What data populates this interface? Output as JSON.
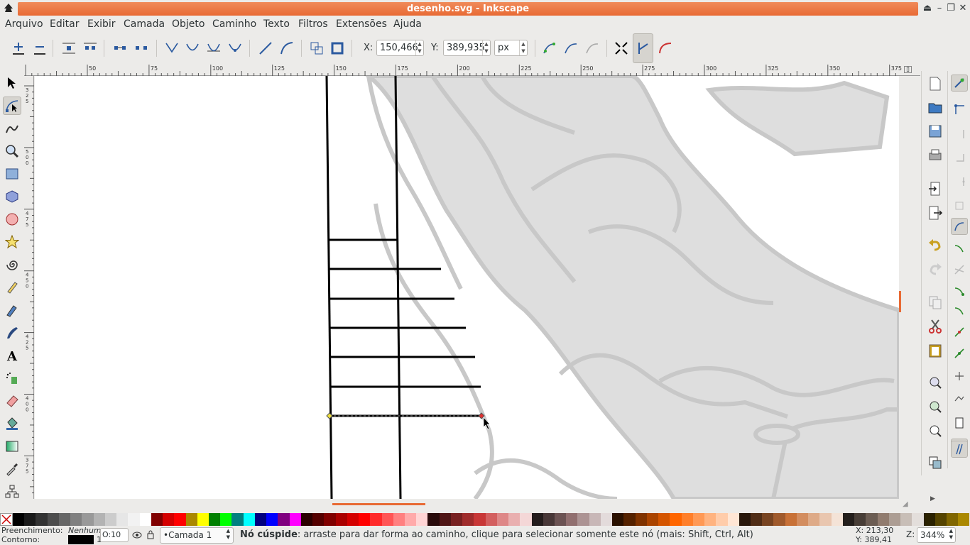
{
  "window": {
    "title": "desenho.svg - Inkscape"
  },
  "menu": [
    "Arquivo",
    "Editar",
    "Exibir",
    "Camada",
    "Objeto",
    "Caminho",
    "Texto",
    "Filtros",
    "Extensões",
    "Ajuda"
  ],
  "node_controls": {
    "x_label": "X:",
    "x_value": "150,466",
    "y_label": "Y:",
    "y_value": "389,935",
    "unit": "px"
  },
  "rulers": {
    "horizontal_ticks": [
      "50",
      "75",
      "100",
      "125",
      "150",
      "175",
      "200",
      "225",
      "250",
      "275",
      "300",
      "325",
      "350",
      "375"
    ],
    "vertical_labels": [
      "3\n2\n5",
      "5\n0\n0",
      "4\n7\n5",
      "4\n5\n0",
      "4\n2\n5",
      "4\n0\n0",
      "3\n7\n5"
    ]
  },
  "palette": {
    "colors": [
      "#000000",
      "#1a1a1a",
      "#333333",
      "#4d4d4d",
      "#666666",
      "#808080",
      "#999999",
      "#b3b3b3",
      "#cccccc",
      "#e6e6e6",
      "#f2f2f2",
      "#ffffff",
      "#800000",
      "#d40000",
      "#ff0000",
      "#aa8800",
      "#ffff00",
      "#008000",
      "#00ff00",
      "#008080",
      "#00ffff",
      "#000080",
      "#0000ff",
      "#800080",
      "#ff00ff",
      "#2b0000",
      "#550000",
      "#800000",
      "#aa0000",
      "#d40000",
      "#ff0000",
      "#ff2a2a",
      "#ff5555",
      "#ff8080",
      "#ffaaaa",
      "#ffd5d5",
      "#280b0b",
      "#501616",
      "#782121",
      "#a02c2c",
      "#c83737",
      "#d35f5f",
      "#de8787",
      "#e9afaf",
      "#f4d7d7",
      "#241c1c",
      "#483737",
      "#6c5353",
      "#916f6f",
      "#ac9393",
      "#c8b7b7",
      "#e3dbdb",
      "#2b1100",
      "#552200",
      "#803300",
      "#aa4400",
      "#d45500",
      "#ff6600",
      "#ff7f2a",
      "#ff9955",
      "#ffb380",
      "#ffccaa",
      "#ffe6d5",
      "#28170b",
      "#502d16",
      "#784421",
      "#a05a2c",
      "#c87137",
      "#d38d5f",
      "#deaa87",
      "#e9c6af",
      "#f4e3d7",
      "#241f1c",
      "#483e37",
      "#6c5d53",
      "#917c6f",
      "#ac9d93",
      "#c8beb7",
      "#e3dedb",
      "#2b2200",
      "#554400",
      "#806600",
      "#aa8800"
    ]
  },
  "status": {
    "fill_label": "Preenchimento:",
    "fill_value": "Nenhum",
    "stroke_label": "Contorno:",
    "stroke_width": "1",
    "opacity": "O:10",
    "layer": "•Camada 1",
    "message_bold": "Nó cúspide",
    "message": ": arraste para dar forma ao caminho, clique para selecionar somente este nó (mais: Shift, Ctrl, Alt)",
    "cursor_x": "X:  213,30",
    "cursor_y": "Y:  389,41",
    "zoom_label": "Z:",
    "zoom": "344%"
  },
  "colors": {
    "title_accent": "#e86a34",
    "node_selected": "#e03030",
    "node_other": "#f0e040"
  }
}
